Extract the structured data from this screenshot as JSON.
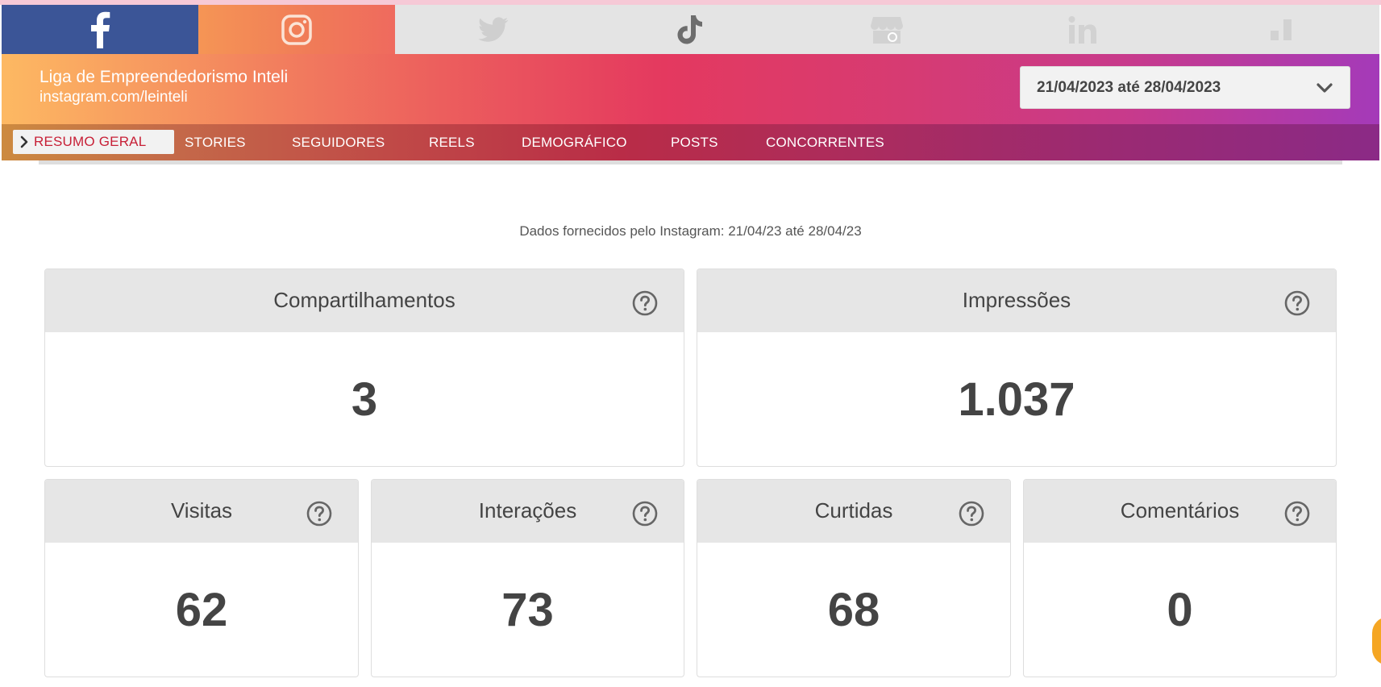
{
  "social_tabs": [
    {
      "name": "facebook",
      "icon": "facebook-icon",
      "active": false
    },
    {
      "name": "instagram",
      "icon": "instagram-icon",
      "active": true
    },
    {
      "name": "twitter",
      "icon": "twitter-icon",
      "active": false
    },
    {
      "name": "tiktok",
      "icon": "tiktok-icon",
      "active": false
    },
    {
      "name": "google-my-business",
      "icon": "store-icon",
      "active": false
    },
    {
      "name": "linkedin",
      "icon": "linkedin-icon",
      "active": false
    },
    {
      "name": "analytics",
      "icon": "bar-chart-icon",
      "active": false
    }
  ],
  "profile": {
    "name": "Liga de Empreendedorismo Inteli",
    "url": "instagram.com/leinteli"
  },
  "date_range": {
    "value": "21/04/2023 até 28/04/2023",
    "icon": "chevron-down-icon"
  },
  "nav": {
    "active": "RESUMO GERAL",
    "items": [
      "STORIES",
      "SEGUIDORES",
      "REELS",
      "DEMOGRÁFICO",
      "POSTS",
      "CONCORRENTES"
    ]
  },
  "data_note": "Dados fornecidos pelo Instagram: 21/04/23 até 28/04/23",
  "metrics": {
    "compartilhamentos": {
      "title": "Compartilhamentos",
      "value": "3"
    },
    "impressoes": {
      "title": "Impressões",
      "value": "1.037"
    },
    "visitas": {
      "title": "Visitas",
      "value": "62"
    },
    "interacoes": {
      "title": "Interações",
      "value": "73"
    },
    "curtidas": {
      "title": "Curtidas",
      "value": "68"
    },
    "comentarios": {
      "title": "Comentários",
      "value": "0"
    }
  },
  "colors": {
    "facebook": "#3b5597",
    "accent_active": "#c72037",
    "card_header": "#e6e6e6",
    "text": "#444444"
  }
}
